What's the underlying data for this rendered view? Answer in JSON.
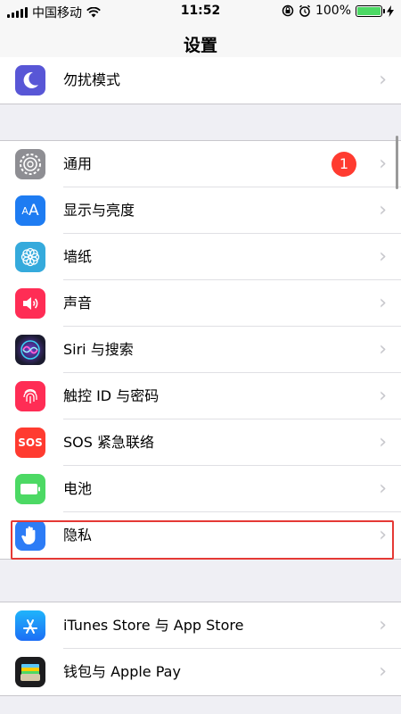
{
  "status_bar": {
    "carrier": "中国移动",
    "time": "11:52",
    "battery": "100%"
  },
  "nav": {
    "title": "设置"
  },
  "group_top": {
    "items": [
      {
        "label": "勿扰模式",
        "icon": "moon-icon",
        "color": "#5856d6"
      }
    ]
  },
  "group_main": {
    "items": [
      {
        "label": "通用",
        "icon": "gear-icon",
        "color": "#8e8e93",
        "badge": "1"
      },
      {
        "label": "显示与亮度",
        "icon": "text-size-icon",
        "color": "#1e7cf2"
      },
      {
        "label": "墙纸",
        "icon": "flower-icon",
        "color": "#35aadc"
      },
      {
        "label": "声音",
        "icon": "speaker-icon",
        "color": "#ff2d55"
      },
      {
        "label": "Siri 与搜索",
        "icon": "siri-icon",
        "color": "#1b1b2f"
      },
      {
        "label": "触控 ID 与密码",
        "icon": "fingerprint-icon",
        "color": "#ff2d55"
      },
      {
        "label": "SOS 紧急联络",
        "icon": "sos-icon",
        "color": "#ff3b30",
        "icon_text": "SOS"
      },
      {
        "label": "电池",
        "icon": "battery-icon",
        "color": "#4cd964"
      },
      {
        "label": "隐私",
        "icon": "hand-icon",
        "color": "#2d7cf6"
      }
    ]
  },
  "group_store": {
    "items": [
      {
        "label": "iTunes Store 与 App Store",
        "icon": "app-store-icon",
        "color": "#1c8ef9"
      },
      {
        "label": "钱包与 Apple Pay",
        "icon": "wallet-icon",
        "color": "#1c1c1e"
      }
    ]
  },
  "accent": {
    "highlight_border": "#e53935",
    "badge": "#ff3b30"
  }
}
